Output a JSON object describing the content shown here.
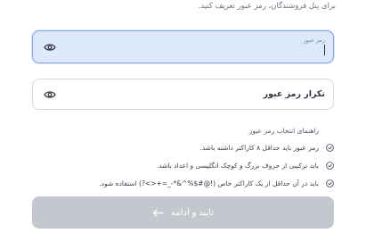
{
  "subtitle": "برای پنل فروشندگان، رمز عبور تعریف کنید.",
  "password": {
    "label": "رمز عبور",
    "value": ""
  },
  "confirm": {
    "placeholder": "تکرار رمز عبور",
    "value": ""
  },
  "guide": {
    "title": "راهنمای انتخاب رمز عبور",
    "rules": [
      "رمز عبور باید حداقل ۸ کاراکتر داشته باشد.",
      "باید ترکیبی از حروف بزرگ و کوچک انگلیسی و اعداد باشد.",
      "باید در آن حداقل از یک کاراکتر خاص (!@#$%^&*-_=+<>?) استفاده شود."
    ]
  },
  "submit": {
    "label": "تایید و ادامه"
  },
  "icons": {
    "eye": "eye-icon",
    "check": "check-circle-icon",
    "arrow": "arrow-left-icon"
  },
  "colors": {
    "active_field_bg": "#dde9fb",
    "active_field_border": "#7fa6e8",
    "button_disabled": "#c4c7cd"
  }
}
